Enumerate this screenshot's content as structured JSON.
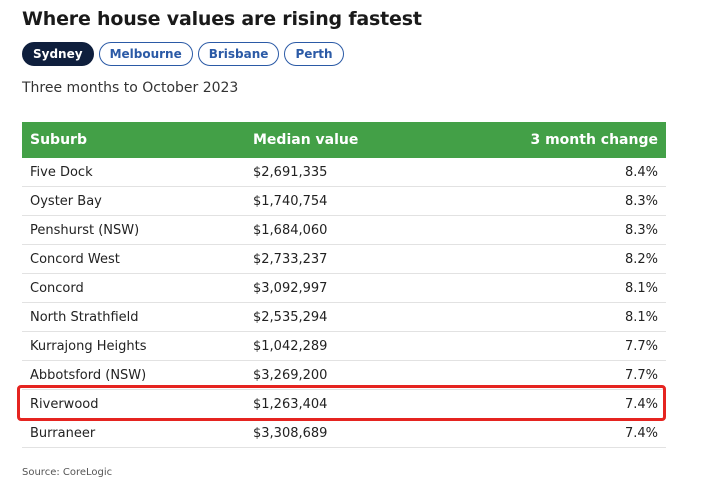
{
  "title": "Where house values are rising fastest",
  "tabs": [
    {
      "label": "Sydney",
      "active": true
    },
    {
      "label": "Melbourne",
      "active": false
    },
    {
      "label": "Brisbane",
      "active": false
    },
    {
      "label": "Perth",
      "active": false
    }
  ],
  "subtitle": "Three months to October 2023",
  "table": {
    "headers": [
      "Suburb",
      "Median value",
      "3 month change"
    ],
    "rows": [
      [
        "Five Dock",
        "$2,691,335",
        "8.4%"
      ],
      [
        "Oyster Bay",
        "$1,740,754",
        "8.3%"
      ],
      [
        "Penshurst (NSW)",
        "$1,684,060",
        "8.3%"
      ],
      [
        "Concord West",
        "$2,733,237",
        "8.2%"
      ],
      [
        "Concord",
        "$3,092,997",
        "8.1%"
      ],
      [
        "North Strathfield",
        "$2,535,294",
        "8.1%"
      ],
      [
        "Kurrajong Heights",
        "$1,042,289",
        "7.7%"
      ],
      [
        "Abbotsford (NSW)",
        "$3,269,200",
        "7.7%"
      ],
      [
        "Riverwood",
        "$1,263,404",
        "7.4%"
      ],
      [
        "Burraneer",
        "$3,308,689",
        "7.4%"
      ]
    ]
  },
  "colors": {
    "header_green": "#43a047",
    "active_tab": "#0f1f3d",
    "tab_blue": "#2b5aa6",
    "highlight_red": "#e52420"
  },
  "source": "Source: CoreLogic"
}
